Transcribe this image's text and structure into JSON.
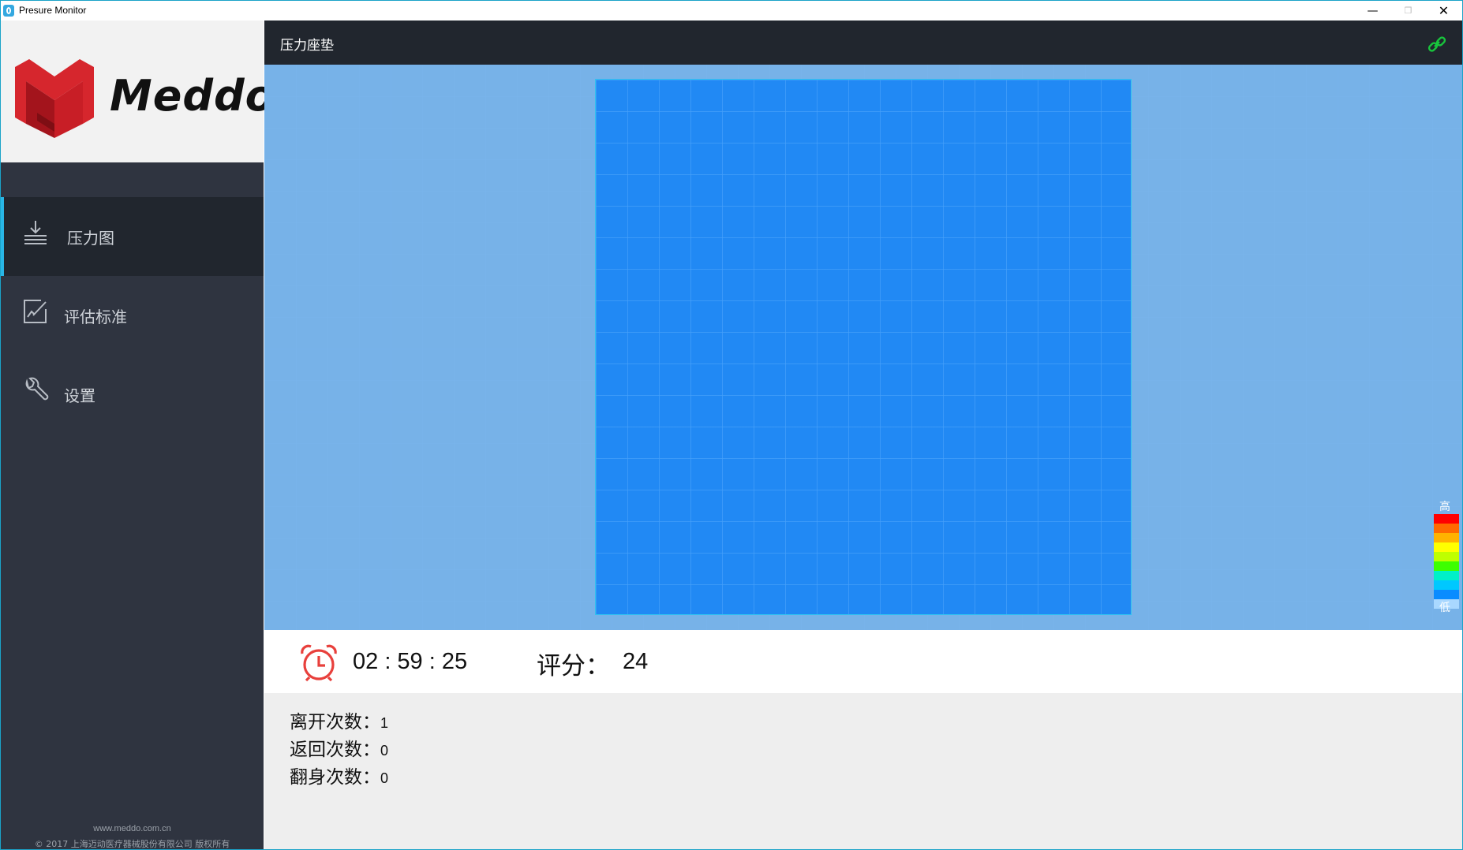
{
  "window": {
    "title": "Presure Monitor",
    "controls": {
      "minimize": "—",
      "maximize": "❐",
      "close": "✕"
    }
  },
  "sidebar": {
    "logo_text": "Meddo",
    "items": [
      {
        "label": "压力图",
        "icon": "pressure-map-icon",
        "active": true
      },
      {
        "label": "评估标准",
        "icon": "evaluation-icon",
        "active": false
      },
      {
        "label": "设置",
        "icon": "wrench-icon",
        "active": false
      }
    ],
    "footer_url": "www.meddo.com.cn",
    "footer_copyright": "© 2017  上海迈动医疗器械股份有限公司 版权所有"
  },
  "header": {
    "title": "压力座垫",
    "connection_icon": "link-icon",
    "connection_color": "#18c43c"
  },
  "pressure_map": {
    "rows": 17,
    "cols": 17,
    "base_color": "#2189f4",
    "legend": {
      "high_label": "高",
      "low_label": "低",
      "colors": [
        "#ff0000",
        "#ff6a00",
        "#ffb300",
        "#ffff00",
        "#bfff00",
        "#3dff00",
        "#00f0c8",
        "#00c8ff",
        "#0a8cff",
        "#a9d8ff"
      ]
    }
  },
  "stats": {
    "timer": "02 : 59 : 25",
    "score_label": "评分：",
    "score_value": "24",
    "clock_icon": "alarm-clock-icon",
    "clock_color": "#e8403c"
  },
  "counts": {
    "leave_label": "离开次数：",
    "leave_value": "1",
    "return_label": "返回次数：",
    "return_value": "0",
    "turn_label": "翻身次数：",
    "turn_value": "0"
  }
}
